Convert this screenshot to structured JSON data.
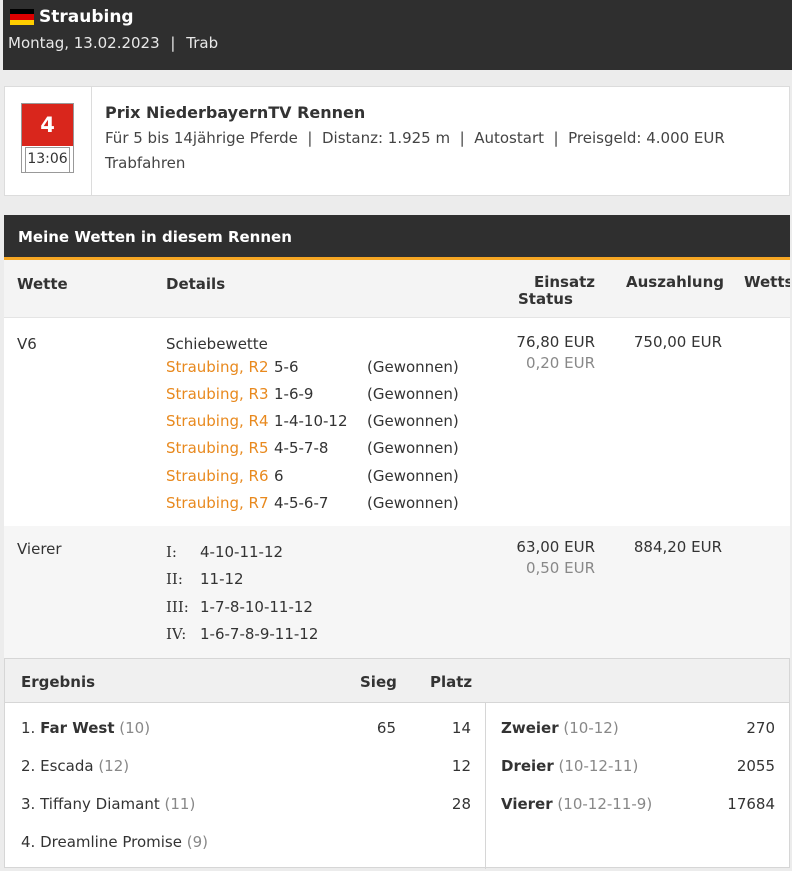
{
  "header": {
    "venue": "Straubing",
    "date": "Montag, 13.02.2023",
    "separator": "|",
    "race_type": "Trab"
  },
  "race": {
    "number": "4",
    "time": "13:06",
    "title": "Prix NiederbayernTV Rennen",
    "info": "Für 5 bis 14jährige Pferde  |  Distanz: 1.925 m  |  Autostart  |  Preisgeld: 4.000 EUR",
    "type": "Trabfahren"
  },
  "bets": {
    "header": "Meine Wetten in diesem Rennen",
    "columns": {
      "wette": "Wette",
      "details": "Details",
      "einsatz": "Einsatz",
      "status": "Status",
      "auszahlung": "Auszahlung",
      "wettschein": "Wetts"
    },
    "v6": {
      "type": "V6",
      "subtype": "Schiebewette",
      "einsatz": "76,80 EUR",
      "status": "0,20 EUR",
      "payout": "750,00 EUR",
      "legs": [
        {
          "race": "Straubing, R2",
          "numbers": "5-6",
          "result": "(Gewonnen)"
        },
        {
          "race": "Straubing, R3",
          "numbers": "1-6-9",
          "result": "(Gewonnen)"
        },
        {
          "race": "Straubing, R4",
          "numbers": "1-4-10-12",
          "result": "(Gewonnen)"
        },
        {
          "race": "Straubing, R5",
          "numbers": "4-5-7-8",
          "result": "(Gewonnen)"
        },
        {
          "race": "Straubing, R6",
          "numbers": "6",
          "result": "(Gewonnen)"
        },
        {
          "race": "Straubing, R7",
          "numbers": "4-5-6-7",
          "result": "(Gewonnen)"
        }
      ]
    },
    "vierer": {
      "type": "Vierer",
      "einsatz": "63,00 EUR",
      "status": "0,50 EUR",
      "payout": "884,20 EUR",
      "positions": [
        {
          "rank": "I:",
          "numbers": "4-10-11-12"
        },
        {
          "rank": "II:",
          "numbers": "11-12"
        },
        {
          "rank": "III:",
          "numbers": "1-7-8-10-11-12"
        },
        {
          "rank": "IV:",
          "numbers": "1-6-7-8-9-11-12"
        }
      ]
    }
  },
  "result": {
    "headers": {
      "ergebnis": "Ergebnis",
      "sieg": "Sieg",
      "platz": "Platz"
    },
    "finishers": [
      {
        "pos": "1.",
        "name": "Far West",
        "num": "(10)",
        "sieg": "65",
        "platz": "14"
      },
      {
        "pos": "2.",
        "name": "Escada",
        "num": "(12)",
        "sieg": "",
        "platz": "12"
      },
      {
        "pos": "3.",
        "name": "Tiffany Diamant",
        "num": "(11)",
        "sieg": "",
        "platz": "28"
      },
      {
        "pos": "4.",
        "name": "Dreamline Promise",
        "num": "(9)",
        "sieg": "",
        "platz": ""
      }
    ],
    "combos": [
      {
        "name": "Zweier",
        "num": "(10-12)",
        "value": "270"
      },
      {
        "name": "Dreier",
        "num": "(10-12-11)",
        "value": "2055"
      },
      {
        "name": "Vierer",
        "num": "(10-12-11-9)",
        "value": "17684"
      }
    ]
  },
  "colors": {
    "header_bg": "#2f2f2f",
    "accent": "#f5a623",
    "race_red": "#d9261c",
    "link_orange": "#e8891e"
  }
}
